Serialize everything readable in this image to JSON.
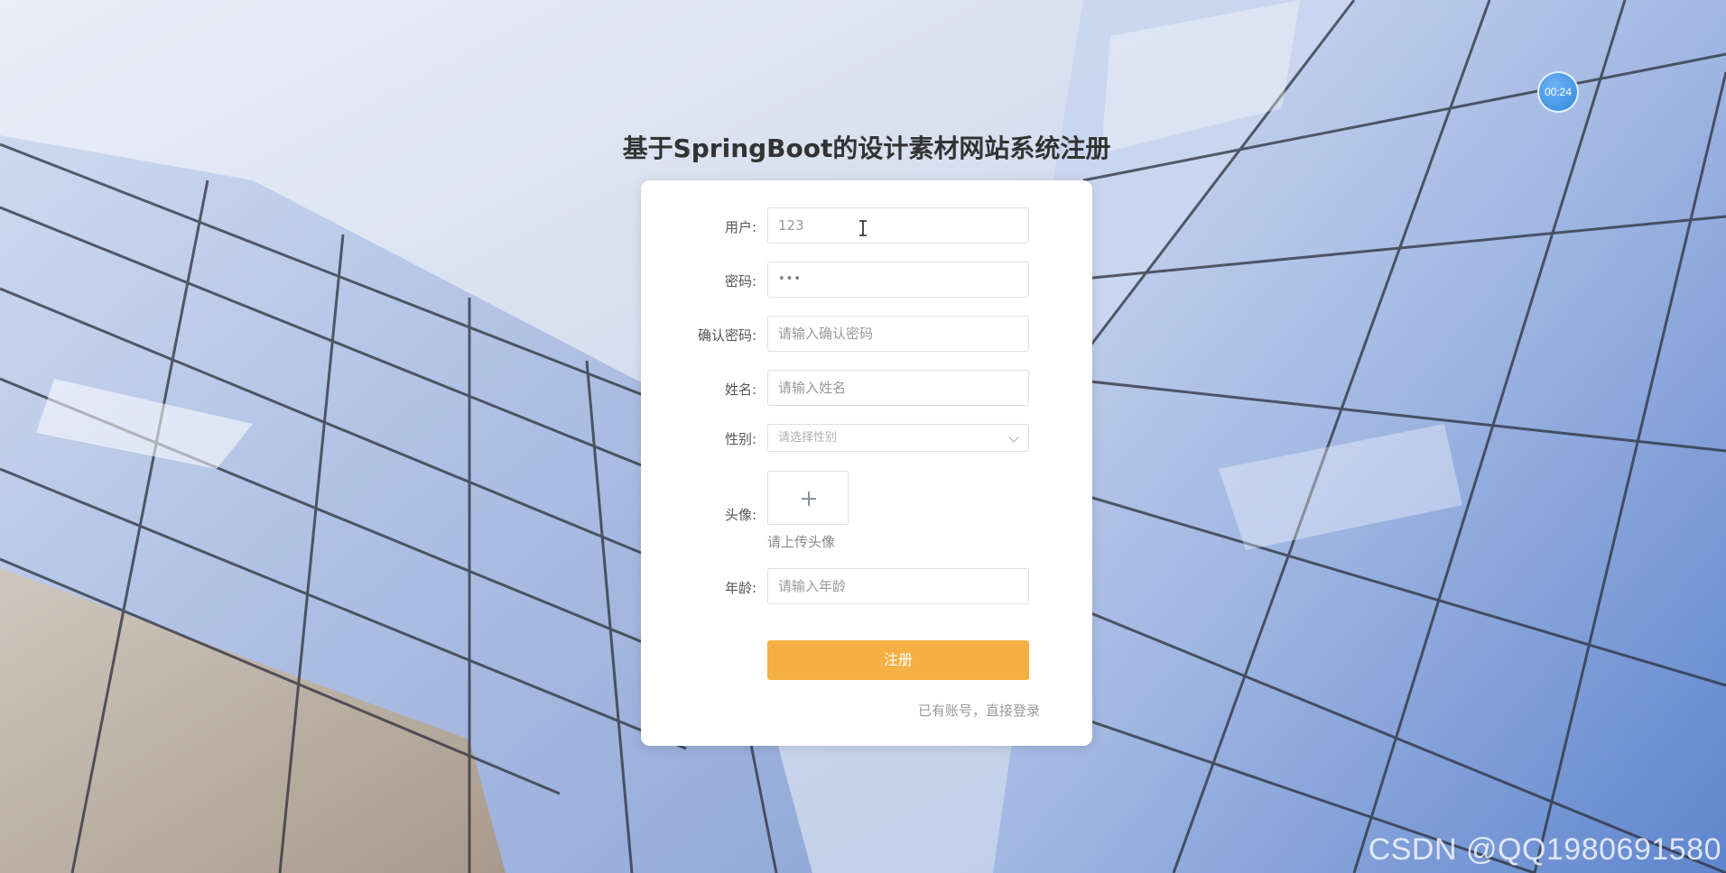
{
  "timer": {
    "text": "00:24"
  },
  "page": {
    "title": "基于SpringBoot的设计素材网站系统注册"
  },
  "form": {
    "username": {
      "label": "用户:",
      "value": "123"
    },
    "password": {
      "label": "密码:",
      "value": "•••"
    },
    "confirm_password": {
      "label": "确认密码:",
      "placeholder": "请输入确认密码"
    },
    "name": {
      "label": "姓名:",
      "placeholder": "请输入姓名"
    },
    "gender": {
      "label": "性别:",
      "placeholder": "请选择性别"
    },
    "avatar": {
      "label": "头像:",
      "tip": "请上传头像"
    },
    "age": {
      "label": "年龄:",
      "placeholder": "请输入年龄"
    },
    "submit_label": "注册",
    "login_link": "已有账号，直接登录"
  },
  "watermark": {
    "text": "CSDN @QQ1980691580"
  },
  "colors": {
    "accent": "#f4b044",
    "timer": "#2f86de"
  },
  "icons": {
    "upload": "plus-icon",
    "select": "chevron-down-icon",
    "cursor": "text-cursor-icon"
  }
}
